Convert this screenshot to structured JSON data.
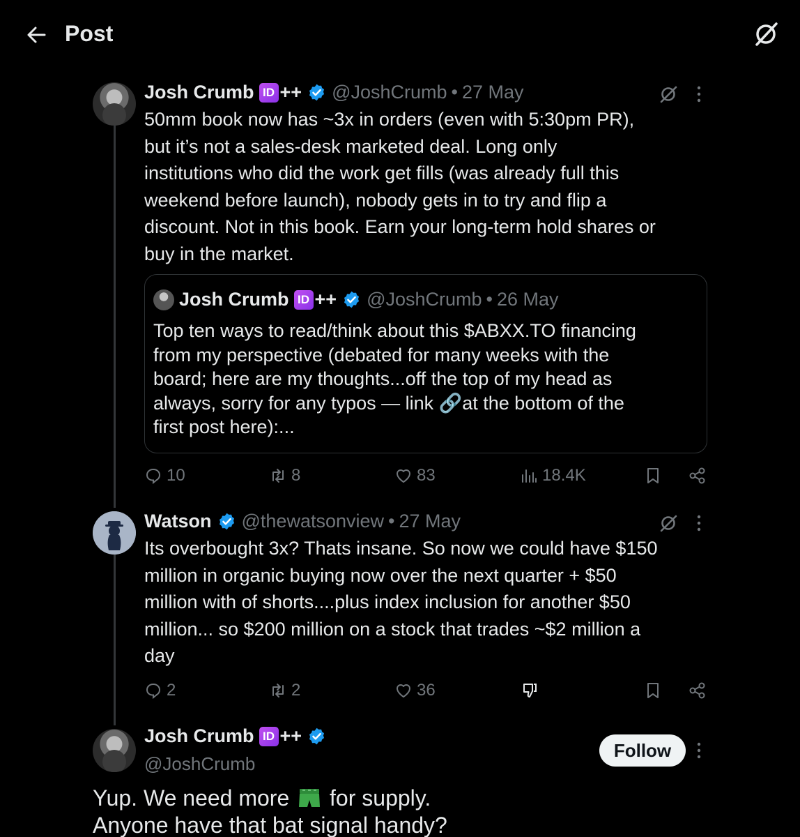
{
  "header": {
    "title": "Post",
    "back_icon": "back-arrow-icon",
    "grok_icon": "grok-icon"
  },
  "colors": {
    "background": "#000000",
    "text": "#e7e9ea",
    "muted": "#71767b",
    "verified": "#1d9bf0",
    "id_badge": "#a23ff0",
    "divider": "#2f3336"
  },
  "posts": [
    {
      "name": "Josh Crumb",
      "badge": "ID",
      "plus": "++",
      "handle": "@JoshCrumb",
      "dot": "•",
      "date": "27 May",
      "text_lines": [
        "50mm book now has ~3x in orders (even with 5:30pm PR),",
        "but it’s not a sales-desk marketed deal.  Long only",
        "institutions who did the work get fills (was already full this",
        "weekend before launch), nobody gets in to try and flip a",
        "discount. Not in this book.  Earn your long-term hold shares or",
        "buy in the market."
      ],
      "quote": {
        "name": "Josh Crumb",
        "badge": "ID",
        "plus": "++",
        "handle": "@JoshCrumb",
        "dot": "•",
        "date": "26 May",
        "text_lines": [
          "Top ten ways to read/think about this $ABXX.TO financing",
          "from my perspective (debated for many weeks with the",
          "board; here are my thoughts...off the top of my head as",
          "always, sorry for any typos — link 🔗at the bottom of the",
          "first post here):..."
        ]
      },
      "actions": {
        "replies": "10",
        "reposts": "8",
        "likes": "83",
        "views": "18.4K"
      }
    },
    {
      "name": "Watson",
      "handle": "@thewatsonview",
      "dot": "•",
      "date": "27 May",
      "text_lines": [
        "Its overbought 3x? Thats insane. So now we could have $150",
        "million in organic buying now over the next quarter + $50",
        "million with of shorts....plus index inclusion for another $50",
        "million... so $200 million on a stock that trades ~$2 million a",
        "day"
      ],
      "actions": {
        "replies": "2",
        "reposts": "2",
        "likes": "36"
      }
    }
  ],
  "reply": {
    "name": "Josh Crumb",
    "badge": "ID",
    "plus": "++",
    "handle": "@JoshCrumb",
    "follow_label": "Follow",
    "text_before": "Yup. We need more",
    "emoji": "shorts-icon",
    "text_after": "for supply.",
    "text_line2": "Anyone have that bat signal handy?"
  }
}
